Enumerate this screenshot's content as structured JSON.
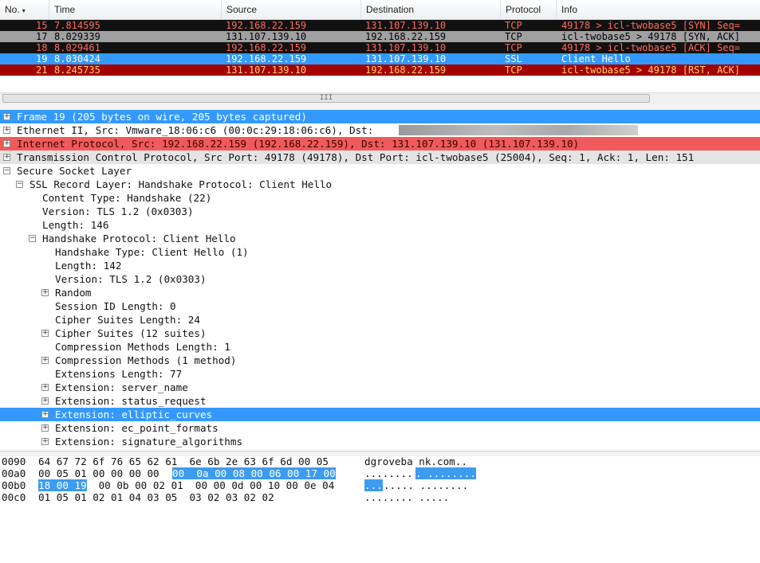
{
  "packet_list": {
    "columns": [
      {
        "label": "No.",
        "sort_indicator": "▾"
      },
      {
        "label": "Time"
      },
      {
        "label": "Source"
      },
      {
        "label": "Destination"
      },
      {
        "label": "Protocol"
      },
      {
        "label": "Info"
      }
    ],
    "rows": [
      {
        "no": "15",
        "time": "7.814595",
        "src": "192.168.22.159",
        "dst": "131.107.139.10",
        "proto": "TCP",
        "info": "49178 > icl-twobase5 [SYN] Seq=",
        "bg": "#111111",
        "fg": "#ff6c5c"
      },
      {
        "no": "17",
        "time": "8.029339",
        "src": "131.107.139.10",
        "dst": "192.168.22.159",
        "proto": "TCP",
        "info": "icl-twobase5 > 49178 [SYN, ACK]",
        "bg": "#a0a0a0",
        "fg": "#000000"
      },
      {
        "no": "18",
        "time": "8.029461",
        "src": "192.168.22.159",
        "dst": "131.107.139.10",
        "proto": "TCP",
        "info": "49178 > icl-twobase5 [ACK] Seq=",
        "bg": "#111111",
        "fg": "#ff6c5c"
      },
      {
        "no": "19",
        "time": "8.030424",
        "src": "192.168.22.159",
        "dst": "131.107.139.10",
        "proto": "SSL",
        "info": "Client Hello",
        "bg": "#3399ff",
        "fg": "#ffffff"
      },
      {
        "no": "21",
        "time": "8.245735",
        "src": "131.107.139.10",
        "dst": "192.168.22.159",
        "proto": "TCP",
        "info": "icl-twobase5 > 49178 [RST, ACK]",
        "bg": "#a40000",
        "fg": "#ffd966"
      }
    ]
  },
  "scrollbar": {
    "grip": "III"
  },
  "tree": [
    {
      "text": "Frame 19 (205 bytes on wire, 205 bytes captured)",
      "level": 0,
      "exp": "+",
      "bg": "#3399ff",
      "fg": "#ffffff"
    },
    {
      "text": "Ethernet II, Src: Vmware_18:06:c6 (00:0c:29:18:06:c6), Dst:",
      "level": 0,
      "exp": "+",
      "bg": "#ffffff",
      "fg": "#111111",
      "redacted": true
    },
    {
      "text": "Internet Protocol, Src: 192.168.22.159 (192.168.22.159), Dst: 131.107.139.10 (131.107.139.10)",
      "level": 0,
      "exp": "+",
      "bg": "#f05a5a",
      "fg": "#3a0000"
    },
    {
      "text": "Transmission Control Protocol, Src Port: 49178 (49178), Dst Port: icl-twobase5 (25004), Seq: 1, Ack: 1, Len: 151",
      "level": 0,
      "exp": "+",
      "bg": "#e4e4e4",
      "fg": "#111111"
    },
    {
      "text": "Secure Socket Layer",
      "level": 0,
      "exp": "−",
      "bg": "#ffffff",
      "fg": "#111111"
    },
    {
      "text": "SSL Record Layer: Handshake Protocol: Client Hello",
      "level": 1,
      "exp": "−",
      "bg": "#ffffff",
      "fg": "#111111"
    },
    {
      "text": "Content Type: Handshake (22)",
      "level": 2,
      "exp": "",
      "bg": "#ffffff",
      "fg": "#111111"
    },
    {
      "text": "Version: TLS 1.2 (0x0303)",
      "level": 2,
      "exp": "",
      "bg": "#ffffff",
      "fg": "#111111"
    },
    {
      "text": "Length: 146",
      "level": 2,
      "exp": "",
      "bg": "#ffffff",
      "fg": "#111111"
    },
    {
      "text": "Handshake Protocol: Client Hello",
      "level": 2,
      "exp": "−",
      "bg": "#ffffff",
      "fg": "#111111"
    },
    {
      "text": "Handshake Type: Client Hello (1)",
      "level": 3,
      "exp": "",
      "bg": "#ffffff",
      "fg": "#111111"
    },
    {
      "text": "Length: 142",
      "level": 3,
      "exp": "",
      "bg": "#ffffff",
      "fg": "#111111"
    },
    {
      "text": "Version: TLS 1.2 (0x0303)",
      "level": 3,
      "exp": "",
      "bg": "#ffffff",
      "fg": "#111111"
    },
    {
      "text": "Random",
      "level": 3,
      "exp": "+",
      "bg": "#ffffff",
      "fg": "#111111"
    },
    {
      "text": "Session ID Length: 0",
      "level": 3,
      "exp": "",
      "bg": "#ffffff",
      "fg": "#111111"
    },
    {
      "text": "Cipher Suites Length: 24",
      "level": 3,
      "exp": "",
      "bg": "#ffffff",
      "fg": "#111111"
    },
    {
      "text": "Cipher Suites (12 suites)",
      "level": 3,
      "exp": "+",
      "bg": "#ffffff",
      "fg": "#111111"
    },
    {
      "text": "Compression Methods Length: 1",
      "level": 3,
      "exp": "",
      "bg": "#ffffff",
      "fg": "#111111"
    },
    {
      "text": "Compression Methods (1 method)",
      "level": 3,
      "exp": "+",
      "bg": "#ffffff",
      "fg": "#111111"
    },
    {
      "text": "Extensions Length: 77",
      "level": 3,
      "exp": "",
      "bg": "#ffffff",
      "fg": "#111111"
    },
    {
      "text": "Extension: server_name",
      "level": 3,
      "exp": "+",
      "bg": "#ffffff",
      "fg": "#111111"
    },
    {
      "text": "Extension: status_request",
      "level": 3,
      "exp": "+",
      "bg": "#ffffff",
      "fg": "#111111"
    },
    {
      "text": "Extension: elliptic_curves",
      "level": 3,
      "exp": "+",
      "bg": "#3399ff",
      "fg": "#ffffff"
    },
    {
      "text": "Extension: ec_point_formats",
      "level": 3,
      "exp": "+",
      "bg": "#ffffff",
      "fg": "#111111"
    },
    {
      "text": "Extension: signature_algorithms",
      "level": 3,
      "exp": "+",
      "bg": "#ffffff",
      "fg": "#111111"
    }
  ],
  "hex": [
    {
      "offset": "0090",
      "bytes": "64 67 72 6f 76 65 62 61  6e 6b 2e 63 6f 6d 00 05",
      "ascii": "dgroveba nk.com..",
      "hl_bytes": "",
      "hl_ascii": ""
    },
    {
      "offset": "00a0",
      "bytes": "00 05 01 00 00 00 00 ",
      "hl_bytes_after": "00  0a 00 08 00 06 00 17 00",
      "ascii": "........",
      "hl_ascii_after": ". ........"
    },
    {
      "offset": "00b0",
      "bytes_hl_before": "18 00 19",
      "bytes": " 00 0b 00 02 01  00 00 0d 00 10 00 0e 04",
      "ascii_hl_before": "...",
      "ascii": "..... ........"
    },
    {
      "offset": "00c0",
      "bytes": "01 05 01 02 01 04 03 05  03 02 03 02 02",
      "ascii": "........ ....."
    }
  ]
}
